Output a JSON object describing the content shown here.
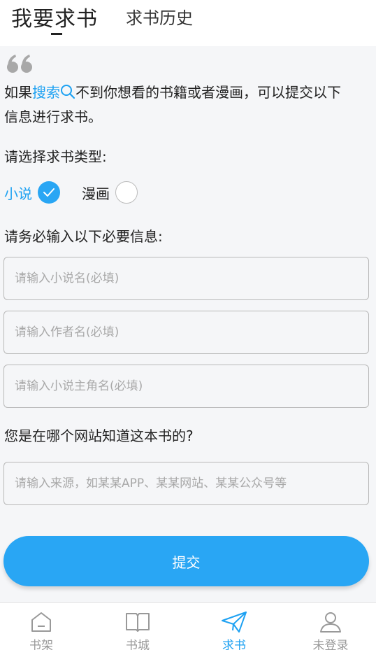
{
  "header": {
    "tab_active": "我要求书",
    "tab_inactive": "求书历史"
  },
  "intro": {
    "prefix": "如果",
    "link": "搜索",
    "rest_line1": "不到你想看的书籍或者漫画，可以提交以下",
    "line2": "信息进行求书。"
  },
  "type_section": {
    "label": "请选择求书类型:",
    "options": [
      {
        "label": "小说",
        "selected": true
      },
      {
        "label": "漫画",
        "selected": false
      }
    ]
  },
  "required_section": {
    "label": "请务必输入以下必要信息:",
    "fields": [
      {
        "placeholder": "请输入小说名(必填)",
        "value": ""
      },
      {
        "placeholder": "请输入作者名(必填)",
        "value": ""
      },
      {
        "placeholder": "请输入小说主角名(必填)",
        "value": ""
      }
    ]
  },
  "source_section": {
    "label": "您是在哪个网站知道这本书的?",
    "placeholder": "请输入来源，如某某APP、某某网站、某某公众号等",
    "value": ""
  },
  "submit_label": "提交",
  "tabbar": {
    "items": [
      {
        "label": "书架",
        "icon": "bookshelf-icon",
        "active": false
      },
      {
        "label": "书城",
        "icon": "book-icon",
        "active": false
      },
      {
        "label": "求书",
        "icon": "paper-plane-icon",
        "active": true
      },
      {
        "label": "未登录",
        "icon": "user-icon",
        "active": false
      }
    ]
  },
  "colors": {
    "accent": "#29a6f4",
    "link": "#1da1f2",
    "background": "#f5f6f8",
    "inactive_tab": "#999999"
  }
}
